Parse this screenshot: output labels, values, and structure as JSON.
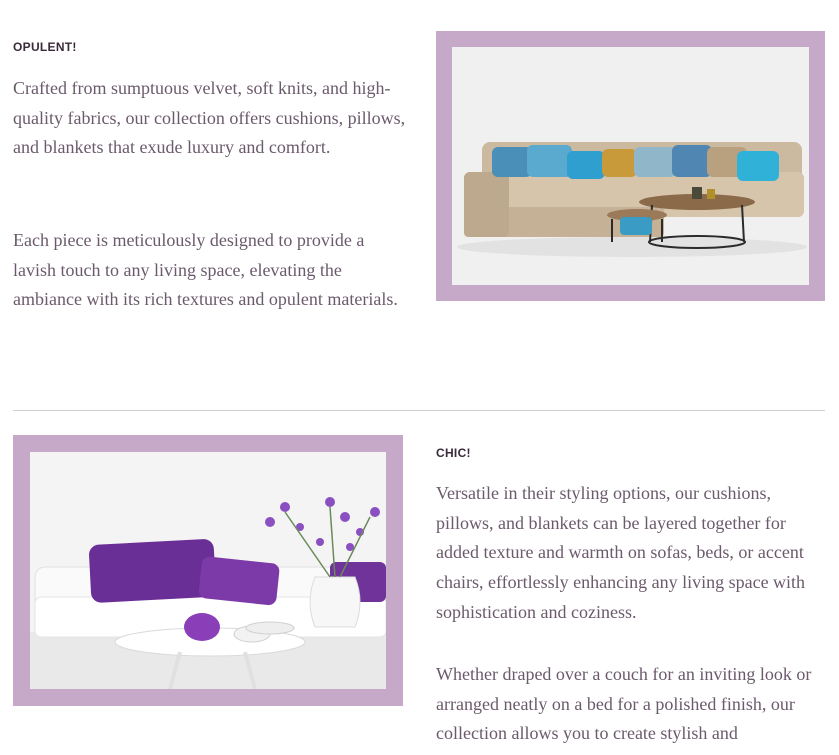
{
  "sections": [
    {
      "heading": "OPULENT!",
      "paragraphs": [
        "Crafted from sumptuous velvet, soft knits, and high-quality fabrics, our collection offers cushions, pillows, and blankets that exude luxury and comfort.",
        "Each piece is meticulously designed to provide a lavish touch to any living space, elevating the ambiance with its rich textures and opulent materials."
      ]
    },
    {
      "heading": "CHIC!",
      "paragraphs": [
        "Versatile in their styling options, our cushions, pillows, and blankets can be layered together for added texture and warmth on sofas, beds, or accent chairs, effortlessly enhancing any living space with sophistication and coziness.",
        "Whether draped over a couch for an inviting look or arranged neatly on a bed for a polished finish, our collection allows you to create stylish and"
      ]
    }
  ],
  "colors": {
    "frame": "#c6a9c9",
    "heading": "#3a2a3a",
    "body_text": "#6b5a6b",
    "divider": "#cfcfcf"
  }
}
